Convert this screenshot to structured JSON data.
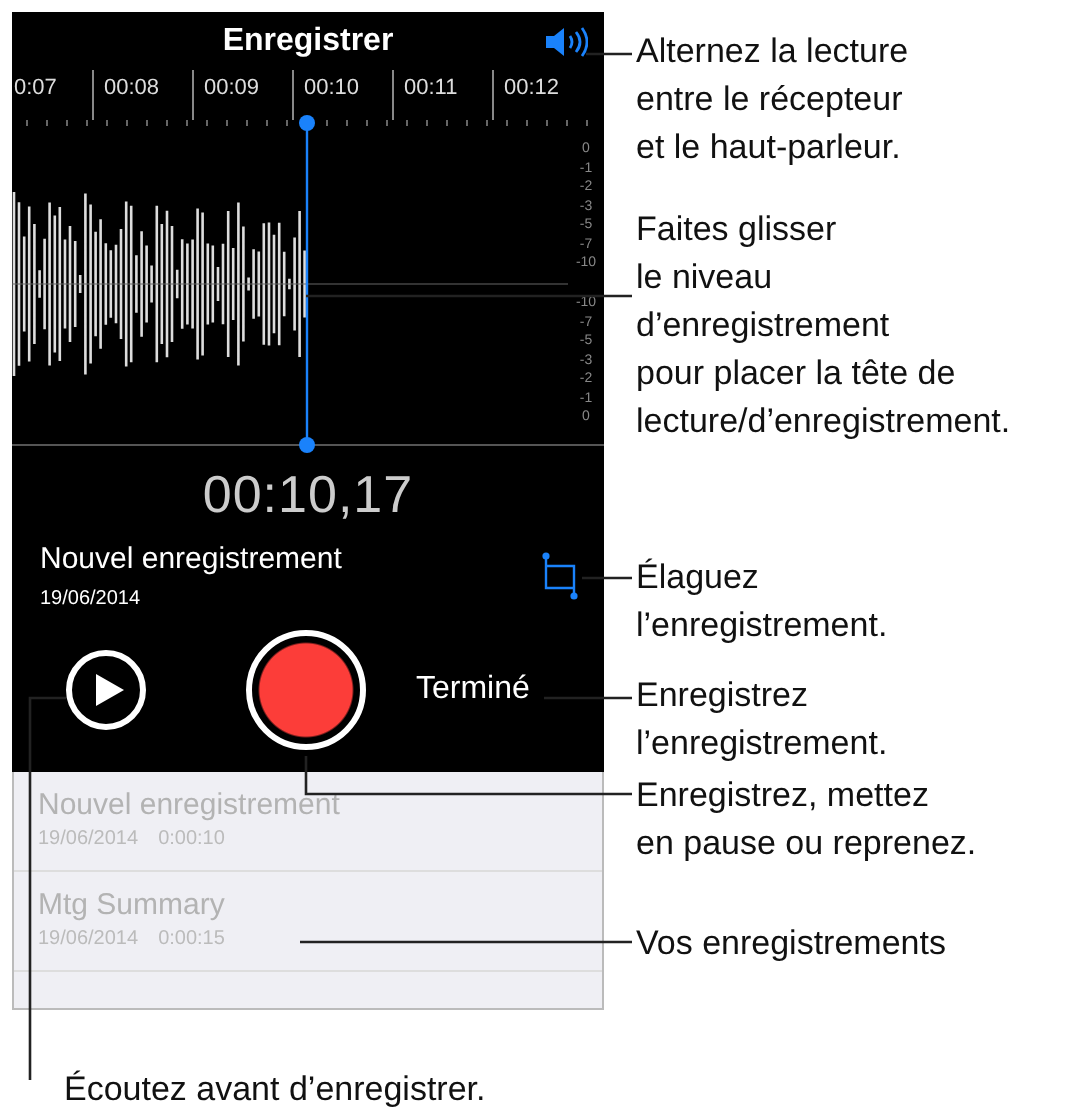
{
  "screen": {
    "title": "Enregistrer",
    "timeline": [
      "0:07",
      "00:08",
      "00:09",
      "00:10",
      "00:11",
      "00:12"
    ],
    "level_scale": [
      "0",
      "-1",
      "-2",
      "-3",
      "-5",
      "-7",
      "-10",
      "-10",
      "-7",
      "-5",
      "-3",
      "-2",
      "-1",
      "0"
    ],
    "elapsed_time": "00:10,17",
    "recording": {
      "name": "Nouvel enregistrement",
      "date": "19/06/2014"
    },
    "done_button": "Terminé",
    "recordings": [
      {
        "name": "Nouvel enregistrement",
        "date": "19/06/2014",
        "duration": "0:00:10"
      },
      {
        "name": "Mtg Summary",
        "date": "19/06/2014",
        "duration": "0:00:15"
      }
    ]
  },
  "callouts": [
    {
      "lines": [
        "Alternez la lecture",
        "entre le récepteur",
        "et le haut-parleur."
      ]
    },
    {
      "lines": [
        "Faites glisser",
        "le niveau",
        "d’enregistrement",
        "pour placer la tête de",
        "lecture/d’enregistrement."
      ]
    },
    {
      "lines": [
        "Élaguez",
        "l’enregistrement."
      ]
    },
    {
      "lines": [
        "Enregistrez",
        "l’enregistrement."
      ]
    },
    {
      "lines": [
        "Enregistrez, mettez",
        "en pause ou reprenez."
      ]
    },
    {
      "lines": [
        "Vos enregistrements"
      ]
    },
    {
      "lines": [
        "Écoutez avant d’enregistrer."
      ]
    }
  ]
}
